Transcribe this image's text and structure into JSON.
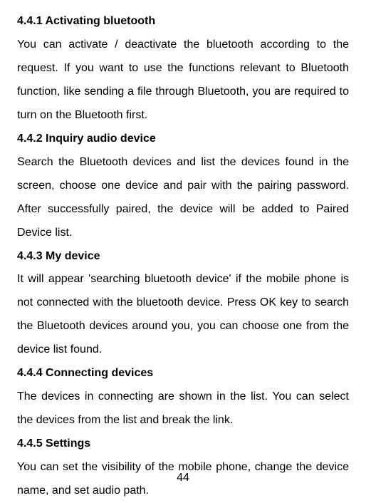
{
  "sections": [
    {
      "heading": "4.4.1 Activating bluetooth",
      "body": "You can activate / deactivate the bluetooth according to the request. If you want to use the functions relevant to Bluetooth function, like sending a file through Bluetooth, you are required to turn on the Bluetooth first."
    },
    {
      "heading": "4.4.2 Inquiry audio device",
      "body": "Search the Bluetooth devices and list the devices found in the screen, choose one device and pair with the pairing password. After successfully paired, the device will be added to Paired Device list."
    },
    {
      "heading": "4.4.3 My device",
      "body": "It will appear 'searching bluetooth device' if the mobile phone is not connected with the bluetooth device. Press OK key to search the Bluetooth devices around you, you can choose one from the device list found."
    },
    {
      "heading": "4.4.4 Connecting devices",
      "body": "The devices in connecting are shown in the list. You can select the devices from the list and break the link."
    },
    {
      "heading": "4.4.5  Settings",
      "body": "You can set the visibility of the mobile phone, change the device name, and set audio path."
    }
  ],
  "pageNumber": "44"
}
